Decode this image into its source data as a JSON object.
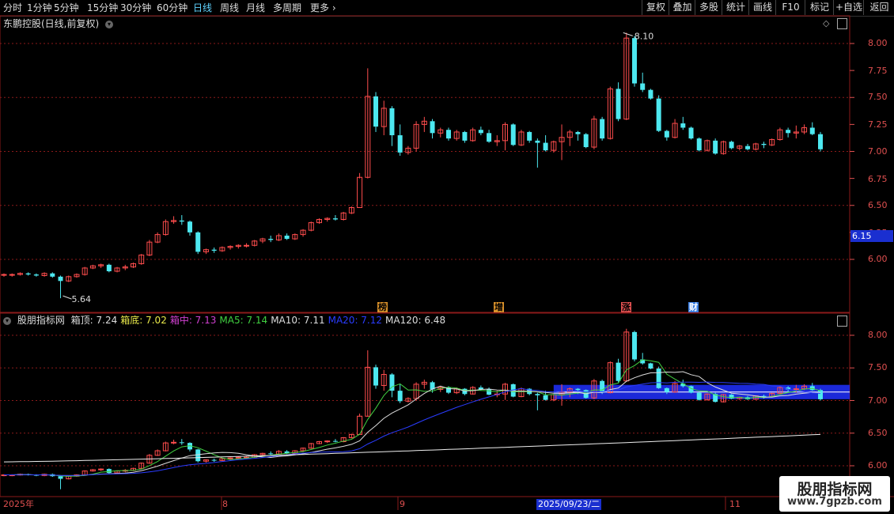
{
  "toolbar": {
    "tabs": [
      "分时",
      "1分钟",
      "5分钟",
      "15分钟",
      "30分钟",
      "60分钟",
      "日线",
      "周线",
      "月线",
      "多周期",
      "更多"
    ],
    "active_tab": "日线",
    "right_buttons": [
      "复权",
      "叠加",
      "多股",
      "统计",
      "画线",
      "F10",
      "标记",
      "+自选",
      "返回"
    ]
  },
  "stock": {
    "title": "东鹏控股(日线,前复权)",
    "high_label": "8.10",
    "low_label": "5.64",
    "current_price_tag": "6.15"
  },
  "upper_axis": [
    "8.00",
    "7.75",
    "7.50",
    "7.25",
    "7.00",
    "6.75",
    "6.50",
    "6.25",
    "6.00"
  ],
  "lower_axis": [
    "8.00",
    "7.50",
    "7.00",
    "6.50",
    "6.00"
  ],
  "markers": [
    "榜",
    "增",
    "涨",
    "财"
  ],
  "indicator": {
    "name": "股朋指标网",
    "items": [
      {
        "label": "箱顶: 7.24",
        "color": "#dddddd"
      },
      {
        "label": "箱底: 7.02",
        "color": "#e8e84a"
      },
      {
        "label": "箱中: 7.13",
        "color": "#d040d0"
      },
      {
        "label": "MA5: 7.14",
        "color": "#40d040"
      },
      {
        "label": "MA10: 7.11",
        "color": "#dddddd"
      },
      {
        "label": "MA20: 7.12",
        "color": "#2a3cff"
      },
      {
        "label": "MA120: 6.48",
        "color": "#dddddd"
      }
    ]
  },
  "dates": {
    "year": "2025年",
    "m8": "8",
    "m9": "9",
    "highlight": "2025/09/23/二",
    "m11": "11"
  },
  "watermark": {
    "title": "股朋指标网",
    "url": "www.7gpzb.com"
  },
  "colors": {
    "up": "#ff4d4d",
    "down": "#4de8f0",
    "bg": "#000000",
    "grid": "#8b1a1a",
    "accent": "#5fd3ff"
  },
  "chart_data": {
    "type": "candlestick",
    "title": "东鹏控股(日线,前复权)",
    "ylim": [
      5.5,
      8.3
    ],
    "ohlc": [
      [
        5.86,
        5.87,
        5.84,
        5.86
      ],
      [
        5.86,
        5.87,
        5.84,
        5.86
      ],
      [
        5.86,
        5.88,
        5.85,
        5.87
      ],
      [
        5.87,
        5.88,
        5.85,
        5.86
      ],
      [
        5.86,
        5.87,
        5.84,
        5.85
      ],
      [
        5.85,
        5.88,
        5.84,
        5.87
      ],
      [
        5.87,
        5.88,
        5.83,
        5.84
      ],
      [
        5.84,
        5.85,
        5.64,
        5.8
      ],
      [
        5.8,
        5.85,
        5.79,
        5.84
      ],
      [
        5.84,
        5.87,
        5.83,
        5.86
      ],
      [
        5.86,
        5.93,
        5.85,
        5.92
      ],
      [
        5.92,
        5.95,
        5.91,
        5.94
      ],
      [
        5.94,
        5.96,
        5.92,
        5.95
      ],
      [
        5.95,
        5.96,
        5.88,
        5.89
      ],
      [
        5.89,
        5.93,
        5.88,
        5.92
      ],
      [
        5.92,
        5.95,
        5.9,
        5.93
      ],
      [
        5.93,
        5.97,
        5.92,
        5.96
      ],
      [
        5.96,
        6.05,
        5.95,
        6.04
      ],
      [
        6.04,
        6.18,
        6.03,
        6.16
      ],
      [
        6.16,
        6.25,
        6.15,
        6.23
      ],
      [
        6.23,
        6.37,
        6.22,
        6.35
      ],
      [
        6.35,
        6.4,
        6.33,
        6.36
      ],
      [
        6.36,
        6.41,
        6.32,
        6.35
      ],
      [
        6.35,
        6.36,
        6.22,
        6.25
      ],
      [
        6.25,
        6.26,
        6.05,
        6.07
      ],
      [
        6.07,
        6.1,
        6.05,
        6.09
      ],
      [
        6.09,
        6.11,
        6.06,
        6.08
      ],
      [
        6.08,
        6.12,
        6.07,
        6.11
      ],
      [
        6.11,
        6.13,
        6.09,
        6.12
      ],
      [
        6.12,
        6.14,
        6.1,
        6.13
      ],
      [
        6.13,
        6.15,
        6.11,
        6.13
      ],
      [
        6.13,
        6.18,
        6.12,
        6.17
      ],
      [
        6.17,
        6.2,
        6.15,
        6.19
      ],
      [
        6.19,
        6.22,
        6.16,
        6.18
      ],
      [
        6.18,
        6.24,
        6.17,
        6.22
      ],
      [
        6.22,
        6.24,
        6.18,
        6.19
      ],
      [
        6.19,
        6.24,
        6.18,
        6.23
      ],
      [
        6.23,
        6.28,
        6.21,
        6.27
      ],
      [
        6.27,
        6.35,
        6.26,
        6.34
      ],
      [
        6.34,
        6.38,
        6.33,
        6.37
      ],
      [
        6.37,
        6.39,
        6.35,
        6.38
      ],
      [
        6.38,
        6.41,
        6.36,
        6.37
      ],
      [
        6.37,
        6.44,
        6.36,
        6.43
      ],
      [
        6.43,
        6.49,
        6.42,
        6.48
      ],
      [
        6.48,
        6.8,
        6.75,
        6.76
      ],
      [
        6.76,
        7.77,
        6.75,
        7.51
      ],
      [
        7.51,
        7.55,
        7.18,
        7.23
      ],
      [
        7.23,
        7.47,
        7.15,
        7.4
      ],
      [
        7.4,
        7.42,
        7.05,
        7.15
      ],
      [
        7.15,
        7.25,
        6.96,
        6.99
      ],
      [
        6.99,
        7.05,
        6.97,
        7.03
      ],
      [
        7.03,
        7.28,
        7.0,
        7.25
      ],
      [
        7.25,
        7.32,
        7.18,
        7.28
      ],
      [
        7.28,
        7.3,
        7.12,
        7.17
      ],
      [
        7.17,
        7.22,
        7.13,
        7.2
      ],
      [
        7.2,
        7.22,
        7.1,
        7.12
      ],
      [
        7.12,
        7.2,
        7.1,
        7.18
      ],
      [
        7.18,
        7.19,
        7.08,
        7.1
      ],
      [
        7.1,
        7.22,
        7.09,
        7.2
      ],
      [
        7.2,
        7.23,
        7.15,
        7.17
      ],
      [
        7.17,
        7.2,
        7.08,
        7.09
      ],
      [
        7.09,
        7.15,
        7.05,
        7.1
      ],
      [
        7.1,
        7.27,
        7.01,
        7.25
      ],
      [
        7.25,
        7.26,
        7.05,
        7.06
      ],
      [
        7.06,
        7.2,
        7.05,
        7.18
      ],
      [
        7.18,
        7.19,
        7.08,
        7.1
      ],
      [
        7.1,
        7.12,
        6.85,
        7.08
      ],
      [
        7.08,
        7.15,
        7.0,
        7.01
      ],
      [
        7.01,
        7.1,
        6.99,
        7.09
      ],
      [
        7.09,
        7.25,
        6.92,
        7.13
      ],
      [
        7.13,
        7.2,
        7.05,
        7.18
      ],
      [
        7.18,
        7.19,
        7.1,
        7.16
      ],
      [
        7.16,
        7.17,
        7.03,
        7.04
      ],
      [
        7.04,
        7.33,
        7.02,
        7.3
      ],
      [
        7.3,
        7.32,
        7.1,
        7.12
      ],
      [
        7.12,
        7.6,
        7.11,
        7.58
      ],
      [
        7.58,
        7.64,
        7.28,
        7.3
      ],
      [
        7.3,
        8.1,
        7.29,
        8.05
      ],
      [
        8.05,
        8.07,
        7.6,
        7.63
      ],
      [
        7.63,
        7.73,
        7.55,
        7.57
      ],
      [
        7.57,
        7.58,
        7.48,
        7.49
      ],
      [
        7.49,
        7.52,
        7.18,
        7.19
      ],
      [
        7.19,
        7.2,
        7.1,
        7.13
      ],
      [
        7.13,
        7.3,
        7.12,
        7.26
      ],
      [
        7.26,
        7.32,
        7.2,
        7.22
      ],
      [
        7.22,
        7.23,
        7.11,
        7.12
      ],
      [
        7.12,
        7.13,
        7.0,
        7.01
      ],
      [
        7.01,
        7.11,
        7.0,
        7.1
      ],
      [
        7.1,
        7.12,
        6.97,
        6.98
      ],
      [
        6.98,
        7.1,
        6.97,
        7.09
      ],
      [
        7.09,
        7.1,
        7.02,
        7.03
      ],
      [
        7.03,
        7.06,
        7.01,
        7.05
      ],
      [
        7.05,
        7.07,
        7.01,
        7.02
      ],
      [
        7.02,
        7.08,
        7.01,
        7.07
      ],
      [
        7.07,
        7.09,
        7.03,
        7.06
      ],
      [
        7.06,
        7.12,
        7.05,
        7.11
      ],
      [
        7.11,
        7.22,
        7.1,
        7.2
      ],
      [
        7.2,
        7.22,
        7.13,
        7.17
      ],
      [
        7.17,
        7.24,
        7.12,
        7.18
      ],
      [
        7.18,
        7.25,
        7.16,
        7.22
      ],
      [
        7.22,
        7.27,
        7.15,
        7.16
      ],
      [
        7.16,
        7.18,
        7.0,
        7.02
      ]
    ],
    "ma120": {
      "start": 6.06,
      "end": 6.48
    },
    "box": {
      "top": 7.24,
      "bottom": 7.02,
      "middle": 7.13
    }
  }
}
